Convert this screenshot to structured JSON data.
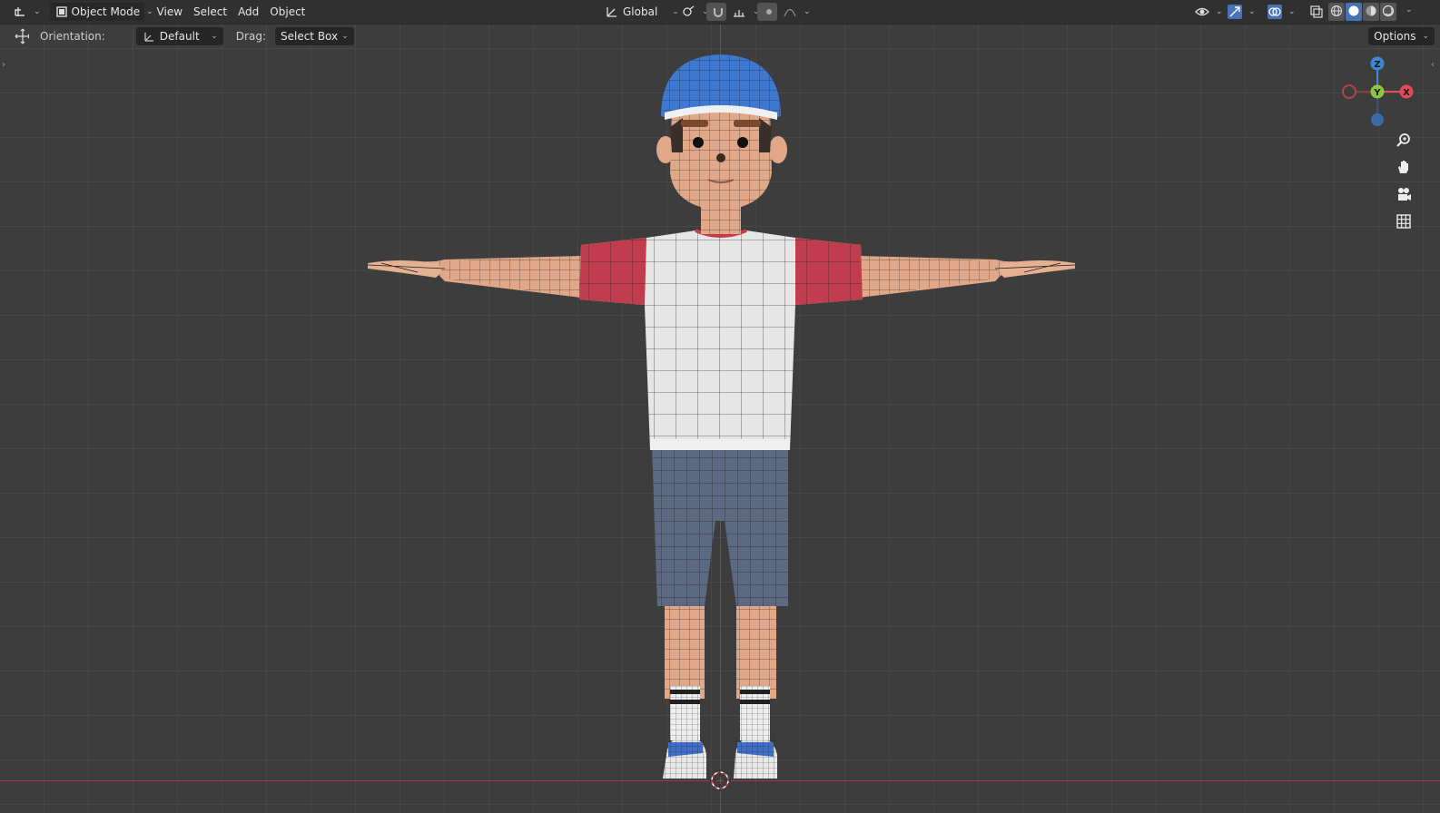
{
  "header": {
    "editor_type_icon": "3d-viewport-icon",
    "mode": "Object Mode",
    "menus": [
      "View",
      "Select",
      "Add",
      "Object"
    ],
    "transform_orientation": "Global",
    "pivot_icon": "pivot-icon",
    "snap_icon": "magnet-icon",
    "proportional_icon": "proportional-edit-icon",
    "right_icons": [
      "visibility-icon",
      "gizmo-icon",
      "overlay-icon",
      "xray-icon"
    ],
    "shading_modes": [
      "wireframe",
      "solid",
      "material-preview",
      "rendered"
    ],
    "shading_active": "solid"
  },
  "tool_header": {
    "tool_icon": "move-icon",
    "orientation_label": "Orientation:",
    "orientation_value": "Default",
    "drag_label": "Drag:",
    "drag_value": "Select Box",
    "options_label": "Options"
  },
  "gizmo": {
    "z_label": "Z",
    "y_label": "Y",
    "x_label": "X",
    "colors": {
      "x": "#e34b5a",
      "y": "#8dc63f",
      "z": "#3d88d6"
    }
  },
  "nav_buttons": [
    "zoom-icon",
    "hand-pan-icon",
    "camera-icon",
    "ortho-grid-icon"
  ],
  "colors": {
    "background": "#3d3d3d",
    "grid": "#474747",
    "header": "#303030",
    "skin": "#e0a889",
    "cap": "#3f78d1",
    "shirt": "#e6e6e6",
    "sleeve": "#c13c4c",
    "shorts": "#5b6a82",
    "accent": "#4772b3"
  }
}
